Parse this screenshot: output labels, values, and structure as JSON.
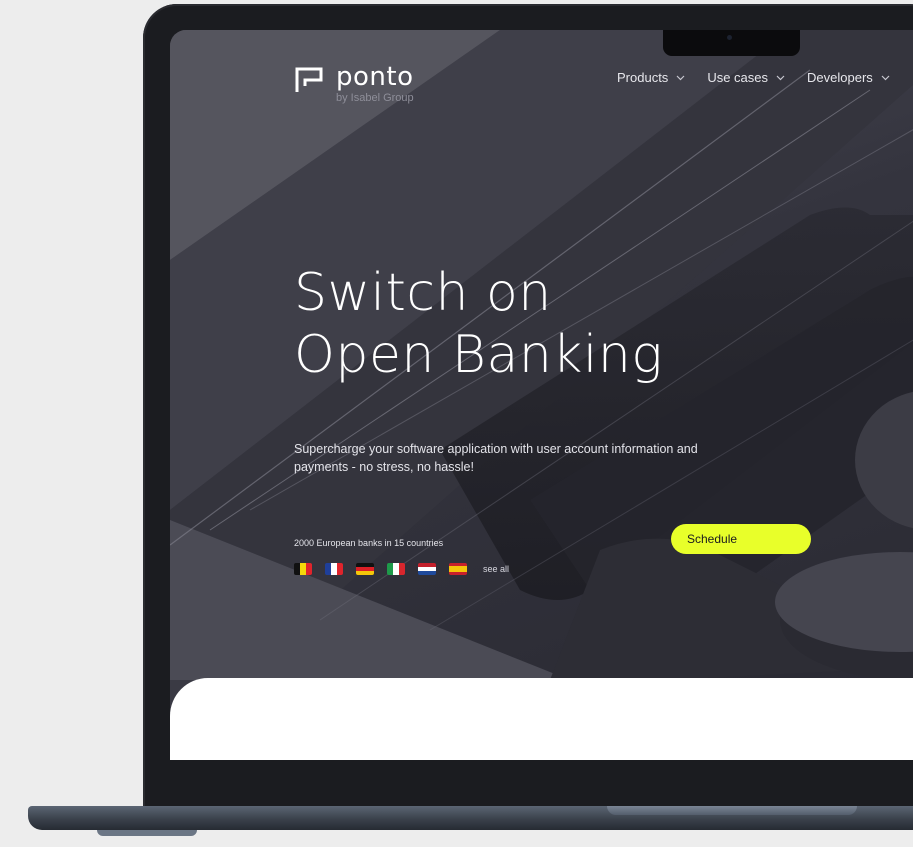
{
  "brand": {
    "name": "ponto",
    "tagline": "by Isabel Group"
  },
  "nav": {
    "items": [
      {
        "label": "Products"
      },
      {
        "label": "Use cases"
      },
      {
        "label": "Developers"
      }
    ]
  },
  "hero": {
    "headline_line1": "Switch on",
    "headline_line2": "Open Banking",
    "subtitle": "Supercharge your software application with user account information and payments - no stress, no hassle!",
    "coverage": "2000 European banks in 15 countries",
    "see_all_label": "see all",
    "cta_label": "Schedule",
    "flags": [
      "belgium-flag-icon",
      "france-flag-icon",
      "germany-flag-icon",
      "italy-flag-icon",
      "netherlands-flag-icon",
      "spain-flag-icon"
    ]
  },
  "colors": {
    "cta_background": "#e8ff2a",
    "hero_background": "#34343e",
    "page_background": "#ededed"
  }
}
